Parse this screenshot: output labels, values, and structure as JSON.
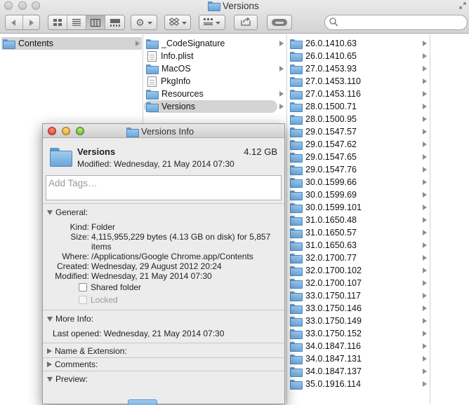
{
  "window": {
    "title": "Versions"
  },
  "toolbar": {
    "search_placeholder": ""
  },
  "column1": {
    "items": [
      {
        "label": "Contents",
        "selected": true
      }
    ]
  },
  "column2": {
    "items": [
      {
        "label": "_CodeSignature",
        "icon": "folder-icon",
        "has_children": true
      },
      {
        "label": "Info.plist",
        "icon": "document-icon",
        "has_children": false
      },
      {
        "label": "MacOS",
        "icon": "folder-icon",
        "has_children": true
      },
      {
        "label": "PkgInfo",
        "icon": "document-icon",
        "has_children": false
      },
      {
        "label": "Resources",
        "icon": "folder-icon",
        "has_children": true
      },
      {
        "label": "Versions",
        "icon": "folder-icon",
        "has_children": true,
        "selected": true
      }
    ]
  },
  "column3": {
    "items": [
      "26.0.1410.63",
      "26.0.1410.65",
      "27.0.1453.93",
      "27.0.1453.110",
      "27.0.1453.116",
      "28.0.1500.71",
      "28.0.1500.95",
      "29.0.1547.57",
      "29.0.1547.62",
      "29.0.1547.65",
      "29.0.1547.76",
      "30.0.1599.66",
      "30.0.1599.69",
      "30.0.1599.101",
      "31.0.1650.48",
      "31.0.1650.57",
      "31.0.1650.63",
      "32.0.1700.77",
      "32.0.1700.102",
      "32.0.1700.107",
      "33.0.1750.117",
      "33.0.1750.146",
      "33.0.1750.149",
      "33.0.1750.152",
      "34.0.1847.116",
      "34.0.1847.131",
      "34.0.1847.137",
      "35.0.1916.114"
    ]
  },
  "info": {
    "title": "Versions Info",
    "name": "Versions",
    "size_summary": "4.12 GB",
    "modified_summary": "Modified: Wednesday, 21 May 2014 07:30",
    "tags_placeholder": "Add Tags…",
    "general": {
      "header": "General:",
      "kind_label": "Kind:",
      "kind": "Folder",
      "size_label": "Size:",
      "size_line1": "4,115,955,229 bytes (4.13 GB on disk) for 5,857",
      "size_line2": "items",
      "where_label": "Where:",
      "where": "/Applications/Google Chrome.app/Contents",
      "created_label": "Created:",
      "created": "Wednesday, 29 August 2012 20:24",
      "modified_label": "Modified:",
      "modified": "Wednesday, 21 May 2014 07:30",
      "shared_label": "Shared folder",
      "shared": false,
      "locked_label": "Locked",
      "locked": false
    },
    "more_info": {
      "header": "More Info:",
      "last_opened": "Last opened: Wednesday, 21 May 2014 07:30"
    },
    "name_ext": {
      "header": "Name & Extension:"
    },
    "comments": {
      "header": "Comments:"
    },
    "preview": {
      "header": "Preview:"
    }
  },
  "colors": {
    "selection": "#d4d4d4",
    "folder": "#7fb3e3"
  }
}
